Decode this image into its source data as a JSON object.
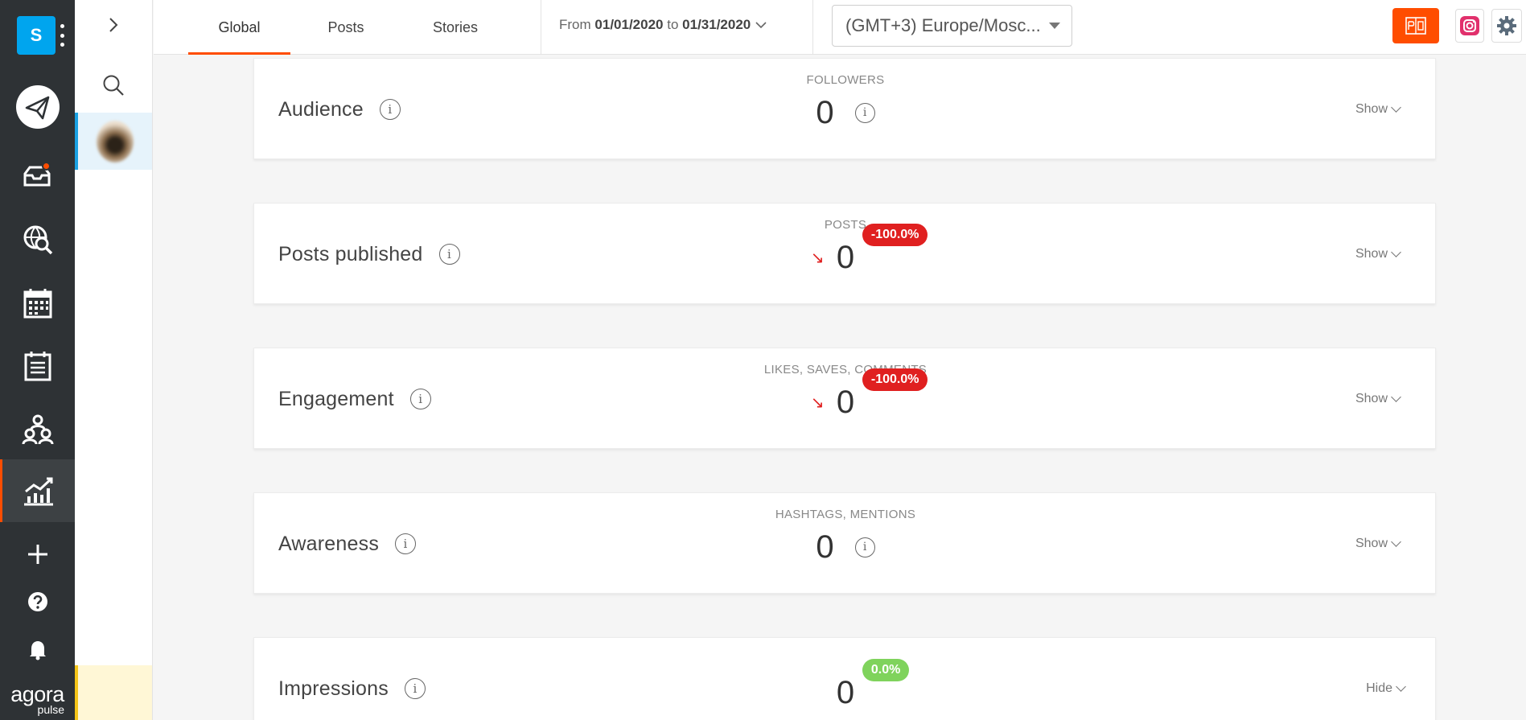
{
  "sidebar": {
    "workspace_initial": "S",
    "logo_line1": "agora",
    "logo_line2": "pulse",
    "items": [
      {
        "name": "publish-icon"
      },
      {
        "name": "inbox-icon",
        "has_notification": true
      },
      {
        "name": "listening-icon"
      },
      {
        "name": "calendar-icon"
      },
      {
        "name": "reports-list-icon"
      },
      {
        "name": "team-icon"
      },
      {
        "name": "analytics-icon",
        "active": true
      },
      {
        "name": "add-icon"
      },
      {
        "name": "help-icon"
      },
      {
        "name": "notifications-icon"
      }
    ]
  },
  "tabs": [
    {
      "label": "Global",
      "active": true
    },
    {
      "label": "Posts",
      "active": false
    },
    {
      "label": "Stories",
      "active": false
    }
  ],
  "date_range": {
    "from_label": "From",
    "from": "01/01/2020",
    "to_label": "to",
    "to": "01/31/2020"
  },
  "timezone": {
    "value": "(GMT+3) Europe/Mosc..."
  },
  "colors": {
    "accent": "#ff4d00",
    "rail": "#2e3235",
    "negative": "#e02020",
    "positive": "#7fd35c",
    "instagram": "#e1306c"
  },
  "cards": [
    {
      "title": "Audience",
      "metric_label": "FOLLOWERS",
      "value": "0",
      "toggle": "Show"
    },
    {
      "title": "Posts published",
      "metric_label": "POSTS",
      "value": "0",
      "change": "-100.0%",
      "toggle": "Show"
    },
    {
      "title": "Engagement",
      "metric_label": "LIKES, SAVES, COMMENTS",
      "value": "0",
      "change": "-100.0%",
      "toggle": "Show"
    },
    {
      "title": "Awareness",
      "metric_label": "HASHTAGS, MENTIONS",
      "value": "0",
      "toggle": "Show"
    },
    {
      "title": "Impressions",
      "metric_label": "",
      "value": "0",
      "change": "0.0%",
      "toggle": "Hide"
    }
  ]
}
